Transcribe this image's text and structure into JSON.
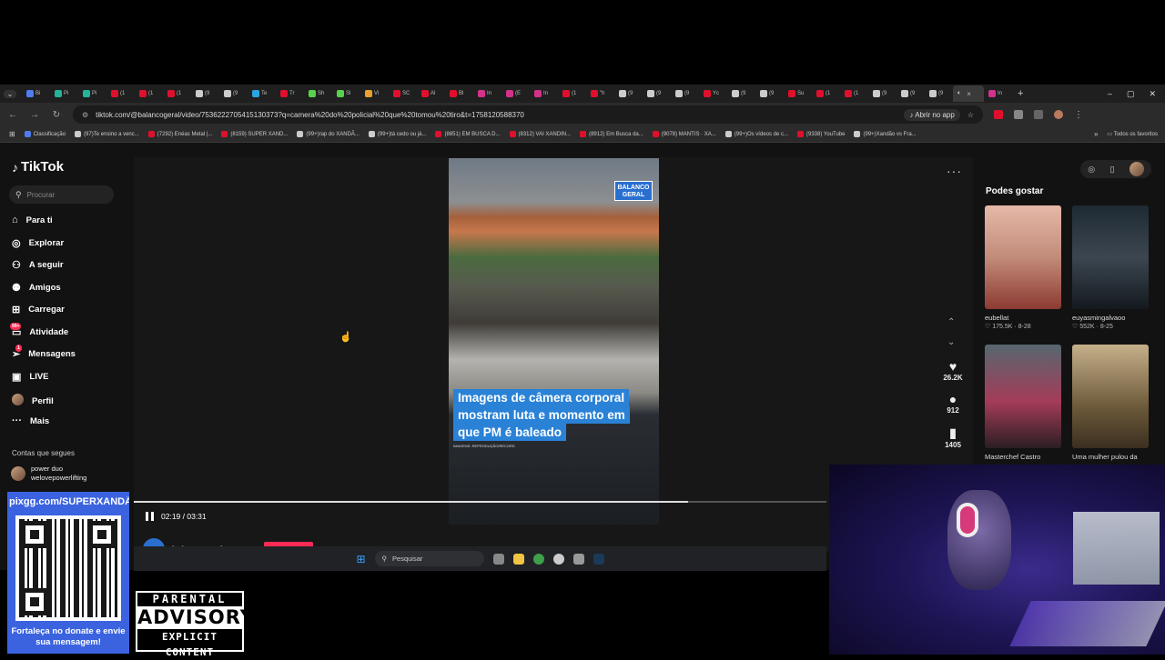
{
  "browser": {
    "tabs": [
      {
        "label": "Bi",
        "color": "#4f7cf0"
      },
      {
        "label": "Pi",
        "color": "#22b59a"
      },
      {
        "label": "Pi",
        "color": "#22b59a"
      },
      {
        "label": "(1",
        "color": "#e0102c"
      },
      {
        "label": "(1",
        "color": "#e0102c"
      },
      {
        "label": "(1",
        "color": "#e0102c"
      },
      {
        "label": "(9",
        "color": "#cccccc"
      },
      {
        "label": "(9",
        "color": "#cccccc"
      },
      {
        "label": "Te",
        "color": "#2aa3e0"
      },
      {
        "label": "Tr",
        "color": "#e0102c"
      },
      {
        "label": "Sh",
        "color": "#58d14a"
      },
      {
        "label": "Sl",
        "color": "#58d14a"
      },
      {
        "label": "Vi",
        "color": "#e8a02e"
      },
      {
        "label": "SC",
        "color": "#e0102c"
      },
      {
        "label": "Al",
        "color": "#e0102c"
      },
      {
        "label": "Bl",
        "color": "#e0102c"
      },
      {
        "label": "In",
        "color": "#d3318a"
      },
      {
        "label": "(E",
        "color": "#d3318a"
      },
      {
        "label": "In",
        "color": "#d3318a"
      },
      {
        "label": "(1",
        "color": "#e0102c"
      },
      {
        "label": "\"h",
        "color": "#e0102c"
      },
      {
        "label": "(9",
        "color": "#cccccc"
      },
      {
        "label": "(9",
        "color": "#cccccc"
      },
      {
        "label": "(9",
        "color": "#cccccc"
      },
      {
        "label": "Yc",
        "color": "#e0102c"
      },
      {
        "label": "(9",
        "color": "#cccccc"
      },
      {
        "label": "(9",
        "color": "#cccccc"
      },
      {
        "label": "Su",
        "color": "#e0102c"
      },
      {
        "label": "(1",
        "color": "#e0102c"
      },
      {
        "label": "(1",
        "color": "#e0102c"
      },
      {
        "label": "(9",
        "color": "#cccccc"
      },
      {
        "label": "(9",
        "color": "#cccccc"
      },
      {
        "label": "(9",
        "color": "#cccccc"
      }
    ],
    "active_tab": {
      "icon": "speaker-icon",
      "close": "×"
    },
    "last_tab": {
      "label": "In",
      "color": "#d3318a"
    },
    "new_tab": "+",
    "window_controls": [
      "–",
      "▢",
      "✕"
    ],
    "url": "tiktok.com/@balancogeral/video/7536222705415130373?q=camera%20do%20policial%20que%20tomou%20tiro&t=1758120588370",
    "open_app": "Abrir no app",
    "bookmarks": [
      {
        "label": "Classificação",
        "color": "#4f7cf0"
      },
      {
        "label": "(97)Te ensino a venc...",
        "color": "#cccccc"
      },
      {
        "label": "(7292) Enéas Metal |...",
        "color": "#e0102c"
      },
      {
        "label": "(8159) SUPER XAND...",
        "color": "#e0102c"
      },
      {
        "label": "(99+)rap do XANDÃ...",
        "color": "#cccccc"
      },
      {
        "label": "(99+)tá cedo ou já...",
        "color": "#cccccc"
      },
      {
        "label": "(8851) EM BUSCA D...",
        "color": "#e0102c"
      },
      {
        "label": "(8312) VAI XANDIN...",
        "color": "#e0102c"
      },
      {
        "label": "(8912) Em Busca da...",
        "color": "#e0102c"
      },
      {
        "label": "(9078) MANTIS · XA...",
        "color": "#e0102c"
      },
      {
        "label": "(99+)Os vídeos de c...",
        "color": "#cccccc"
      },
      {
        "label": "(9338) YouTube",
        "color": "#e0102c"
      },
      {
        "label": "(99+)Xandão vs Fra...",
        "color": "#cccccc"
      }
    ],
    "bookmarks_more": "»",
    "all_bookmarks": "Todos os favoritos"
  },
  "tiktok": {
    "logo": "TikTok",
    "search_placeholder": "Procurar",
    "menu": [
      {
        "label": "Para ti",
        "icon": "home-icon",
        "glyph": "⌂"
      },
      {
        "label": "Explorar",
        "icon": "compass-icon",
        "glyph": "◎"
      },
      {
        "label": "A seguir",
        "icon": "following-icon",
        "glyph": "⚇"
      },
      {
        "label": "Amigos",
        "icon": "friends-icon",
        "glyph": "⚉"
      },
      {
        "label": "Carregar",
        "icon": "upload-icon",
        "glyph": "⊞"
      },
      {
        "label": "Atividade",
        "icon": "activity-icon",
        "glyph": "▭",
        "badge": "99+"
      },
      {
        "label": "Mensagens",
        "icon": "messages-icon",
        "glyph": "➢",
        "badge": "1"
      },
      {
        "label": "LIVE",
        "icon": "live-icon",
        "glyph": "▣"
      },
      {
        "label": "Perfil",
        "icon": "profile-avatar",
        "glyph": "●"
      },
      {
        "label": "Mais",
        "icon": "more-icon",
        "glyph": "···"
      }
    ],
    "following_label": "Contas que segues",
    "following": [
      {
        "name_line1": "power duo",
        "name_line2": "welovepowerlifting"
      }
    ],
    "video": {
      "channel_tag": "BALANCO\nGERAL",
      "caption_lines": [
        "Imagens de câmera corporal",
        "mostram luta e momento em",
        "que PM é baleado"
      ],
      "caption_credit": "IMAGENS: REPRODUÇÃO/RECORD",
      "time": "02:19 / 03:31",
      "progress": 0.8,
      "author": "balancogeral",
      "likes": "26.2K",
      "comments": "912",
      "saves": "1405"
    },
    "suggestions_title": "Podes gostar",
    "suggestions": [
      {
        "user": "eubellat",
        "likes": "175.5K",
        "date": "8-28",
        "bg": "linear-gradient(180deg,#e6b9a8,#c28b7a 50%,#8d3a33)"
      },
      {
        "user": "euyasmingalvaoo",
        "likes": "552K",
        "date": "8-25",
        "bg": "linear-gradient(180deg,#1e2a33,#3c4650 50%,#141a1f)"
      },
      {
        "user": "Masterchef Castro",
        "likes": "",
        "date": "",
        "bg": "linear-gradient(180deg,#56676f,#a53c59 55%,#2a1e22)"
      },
      {
        "user": "Uma mulher pulou da",
        "likes": "",
        "date": "",
        "bg": "linear-gradient(180deg,#c5b08a,#6d5a3a 60%,#3b2f20)"
      }
    ]
  },
  "taskbar": {
    "search_placeholder": "Pesquisar"
  },
  "overlay": {
    "donate_url": "pixgg.com/SUPERXANDÃO",
    "donate_caption": "Fortaleça no donate e envie sua mensagem!",
    "advisory_top": "PARENTAL",
    "advisory_mid": "ADVISORY",
    "advisory_bot": "EXPLICIT CONTENT"
  }
}
